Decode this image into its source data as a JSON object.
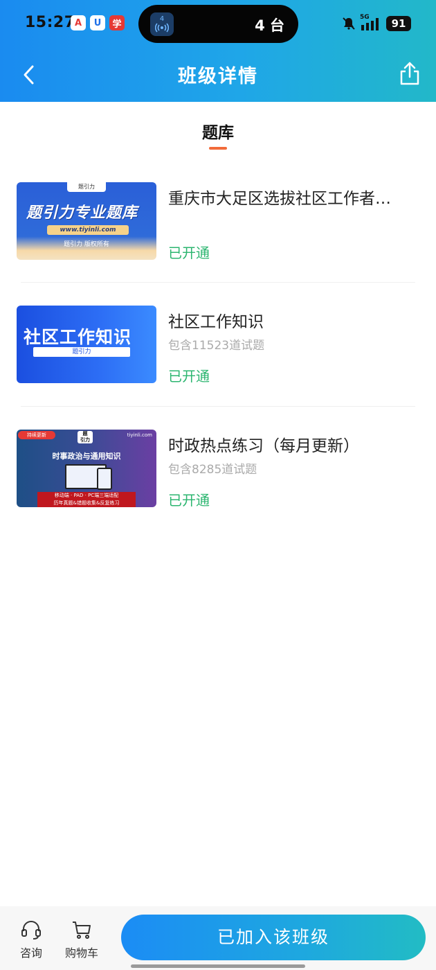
{
  "status_bar": {
    "time": "15:27",
    "app_icons": [
      "A",
      "U",
      "学"
    ],
    "island_app_number": "4",
    "island_text": "4 台",
    "network": "5G",
    "battery": "91"
  },
  "nav": {
    "title": "班级详情",
    "back_icon": "chevron-left-icon",
    "share_icon": "share-icon"
  },
  "tab": {
    "label": "题库",
    "accent_color": "#f26b3a"
  },
  "courses": [
    {
      "title": "重庆市大足区选拔社区工作者…",
      "count": "",
      "status": "已开通",
      "thumb": {
        "chip": "题引力",
        "headline": "题引力专业题库",
        "url": "www.tiyinli.com",
        "copyright": "题引力 版权所有"
      }
    },
    {
      "title": "社区工作知识",
      "count": "包含11523道试题",
      "status": "已开通",
      "thumb": {
        "headline": "社区工作知识",
        "bar": "题引力"
      }
    },
    {
      "title": "时政热点练习（每月更新）",
      "count": "包含8285道试题",
      "status": "已开通",
      "thumb": {
        "badge": "持续更新",
        "site": "tiyinli.com",
        "headline": "时事政治与通用知识",
        "line1": "移动端 · PAD · PC端三端适配",
        "line2": "历年真题&错题收集&反复练习"
      }
    }
  ],
  "bottom": {
    "consult_label": "咨询",
    "cart_label": "购物车",
    "join_button": "已加入该班级"
  },
  "colors": {
    "header_gradient_start": "#1a8bf0",
    "header_gradient_end": "#22b8c9",
    "status_open": "#2bb56f"
  }
}
